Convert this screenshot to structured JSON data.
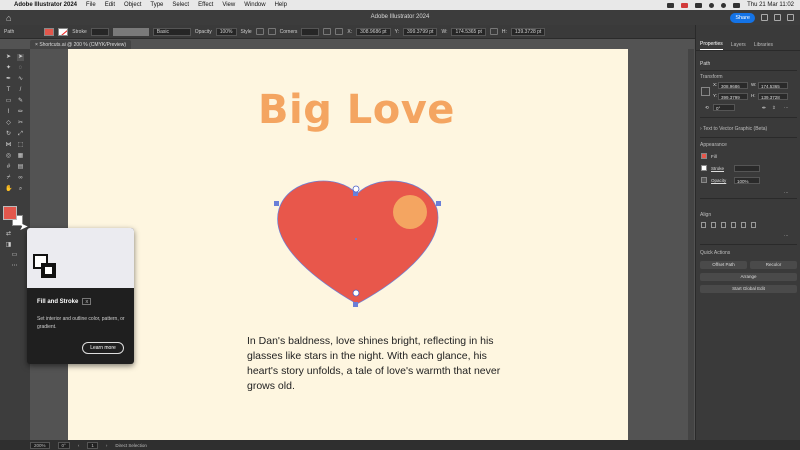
{
  "menubar": {
    "items": [
      "Adobe Illustrator 2024",
      "File",
      "Edit",
      "Object",
      "Type",
      "Select",
      "Effect",
      "View",
      "Window",
      "Help"
    ],
    "clock": "Thu 21 Mar  11:02"
  },
  "appbar": {
    "title": "Adobe Illustrator 2024",
    "share": "Share"
  },
  "control": {
    "selection": "Path",
    "stroke_label": "Stroke",
    "brush": "Basic",
    "opacity_label": "Opacity",
    "opacity": "100%",
    "style_label": "Style",
    "corners_label": "Corners",
    "x": "308.9686 pt",
    "y": "399.3799 pt",
    "w": "174.5365 pt",
    "h": "139.3728 pt"
  },
  "document": {
    "tab": "Shortcuts.ai @ 200 % (CMYK/Preview)",
    "title": "Big Love",
    "body": "In Dan's baldness, love shines bright, reflecting in his glasses like stars in the night. With each glance, his heart's story unfolds, a tale of love's warmth that never grows old."
  },
  "tooltip": {
    "title": "Fill and Stroke",
    "shortcut": "X",
    "description": "Set interior and outline color, pattern, or gradient.",
    "learn_more": "Learn more"
  },
  "panel": {
    "tabs": [
      "Properties",
      "Layers",
      "Libraries"
    ],
    "selection": "Path",
    "transform_label": "Transform",
    "x": "308.9686",
    "y": "399.3799",
    "w": "174.5365",
    "h": "139.3728",
    "angle": "0°",
    "text_to_vector": "Text to Vector Graphic (Beta)",
    "appearance_label": "Appearance",
    "fill_label": "Fill",
    "stroke_label": "Stroke",
    "opacity_label": "Opacity",
    "opacity_value": "100%",
    "align_label": "Align",
    "quick_actions_label": "Quick Actions",
    "offset_path": "Offset Path",
    "recolor": "Recolor",
    "arrange": "Arrange",
    "global_edit": "Start Global Edit"
  },
  "status": {
    "zoom": "200%",
    "rotation": "0°",
    "artboard": "1",
    "tool": "Direct Selection"
  },
  "colors": {
    "heart": "#e8574b",
    "circle": "#f4a561",
    "title": "#f4a561",
    "artboard": "#fef6e0",
    "accent": "#1473e6"
  }
}
